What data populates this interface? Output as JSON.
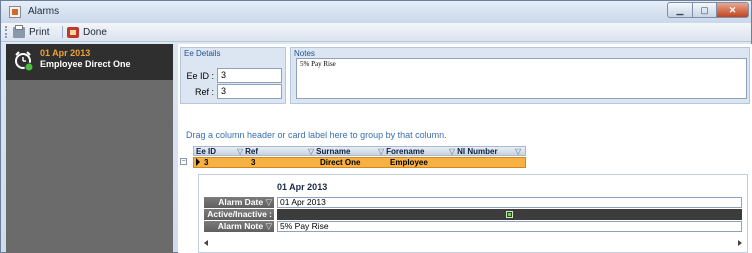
{
  "window": {
    "title": "Alarms"
  },
  "toolbar": {
    "print_label": "Print",
    "done_label": "Done"
  },
  "sidebar": {
    "items": [
      {
        "date": "01 Apr 2013",
        "name": "Employee Direct One"
      }
    ]
  },
  "ee_details": {
    "title": "Ee Details",
    "ee_id_label": "Ee ID :",
    "ee_id_value": "3",
    "ref_label": "Ref :",
    "ref_value": "3"
  },
  "notes": {
    "title": "Notes",
    "value": "5% Pay Rise"
  },
  "grid": {
    "group_hint": "Drag a column header or card label here to group by that column.",
    "columns": [
      "Ee ID",
      "Ref",
      "Surname",
      "Forename",
      "NI Number"
    ],
    "rows": [
      {
        "ee_id": "3",
        "ref": "3",
        "surname": "Direct One",
        "forename": "Employee",
        "ni_number": ""
      }
    ]
  },
  "card": {
    "header_date": "01 Apr 2013",
    "fields": [
      {
        "label": "Alarm Date",
        "value": "01 Apr 2013"
      },
      {
        "label": "Active/Inactive :",
        "value": ""
      },
      {
        "label": "Alarm Note",
        "value": "5% Pay Rise"
      }
    ]
  },
  "colors": {
    "selected_row": "#f7b042",
    "sidebar_date": "#f0a22e",
    "accent_text": "#3a6fb0"
  }
}
